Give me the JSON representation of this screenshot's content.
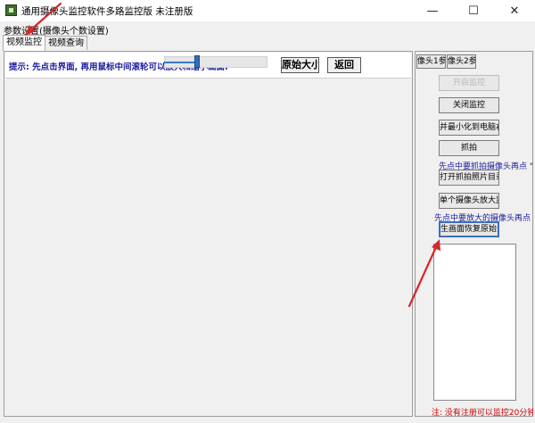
{
  "window": {
    "title": "通用摄像头监控软件多路监控版 未注册版",
    "controls": {
      "minimize": "—",
      "maximize": "☐",
      "close": "✕"
    }
  },
  "menu": {
    "items": [
      "参数设置(摄像头个数设置)"
    ]
  },
  "tabs": [
    "视频监控",
    "视频查询"
  ],
  "toolbar": {
    "tip": "提示: 先点击界面, 再用鼠标中间滚轮可以放大和缩小画面:",
    "zoom_level": 0.32,
    "original_size_label": "原始大小",
    "back_label": "返回"
  },
  "right_panel": {
    "cam_tabs": [
      "像头1参",
      "像头2参"
    ],
    "buttons": {
      "start_monitor": "开启监控",
      "stop_monitor": "关闭监控",
      "minimize_tray": "并最小化到电脑右下",
      "capture": "抓拍",
      "open_photo_dir": "打开抓拍照片目录",
      "single_zoom": "单个摄像头放大监控",
      "restore_screen": "生画面恢复原始大"
    },
    "notes": {
      "capture_hint": "先点中要抓拍摄像头再点 \"",
      "zoom_hint": "先点中要放大的摄像头再点 \""
    }
  },
  "status_text": "注: 没有注册可以监控20分钟,",
  "colors": {
    "arrow": "#d62828",
    "hint_text": "#1a1a9e",
    "status_text": "#cc0000",
    "slider_accent": "#2f6fbd"
  }
}
